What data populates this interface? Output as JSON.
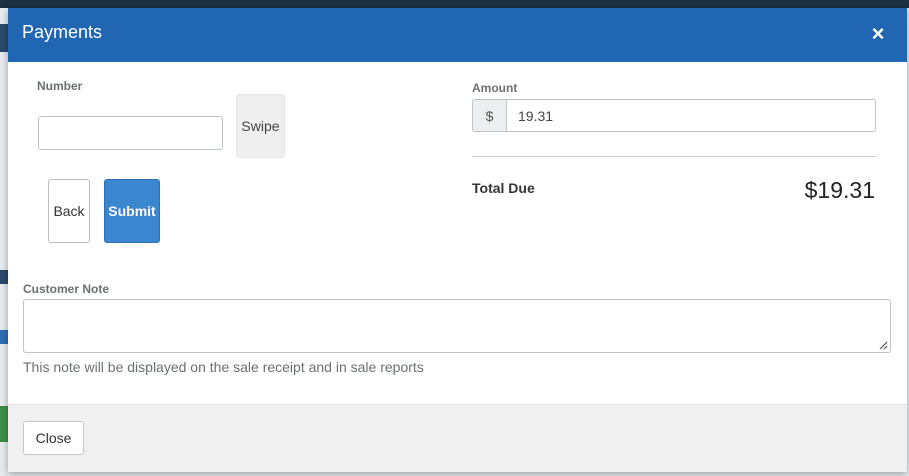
{
  "modal": {
    "title": "Payments",
    "close_icon": "close-icon"
  },
  "card": {
    "number_label": "Number",
    "number_value": "",
    "swipe_label": "Swipe",
    "back_label": "Back",
    "submit_label": "Submit"
  },
  "amount": {
    "label": "Amount",
    "currency_symbol": "$",
    "value": "19.31"
  },
  "total": {
    "label": "Total Due",
    "value": "$19.31"
  },
  "note": {
    "label": "Customer Note",
    "value": "",
    "help_text": "This note will be displayed on the sale receipt and in sale reports"
  },
  "footer": {
    "close_label": "Close"
  },
  "colors": {
    "header": "#2066b2",
    "submit": "#3a87d0",
    "footer": "#f0f0f0"
  }
}
